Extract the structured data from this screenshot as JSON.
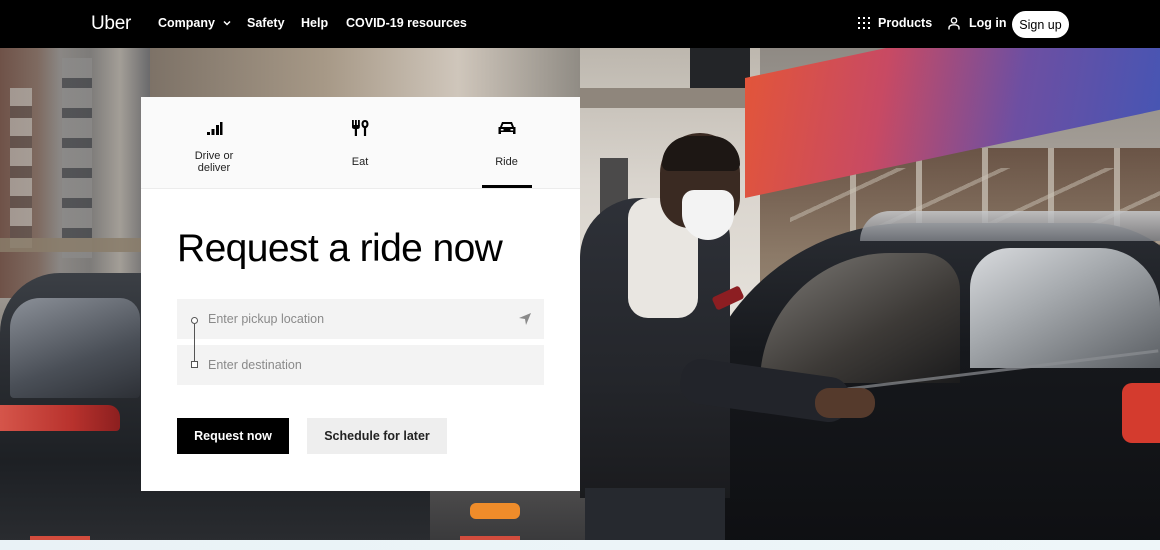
{
  "nav": {
    "logo": "Uber",
    "links": [
      {
        "label": "Company",
        "has_dropdown": true
      },
      {
        "label": "Safety"
      },
      {
        "label": "Help"
      },
      {
        "label": "COVID-19 resources"
      }
    ],
    "products_label": "Products",
    "login_label": "Log in",
    "signup_label": "Sign up"
  },
  "card": {
    "tabs": [
      {
        "label": "Drive or deliver",
        "icon": "signal-bars-icon",
        "active": false
      },
      {
        "label": "Eat",
        "icon": "fork-spoon-icon",
        "active": false
      },
      {
        "label": "Ride",
        "icon": "car-icon",
        "active": true
      }
    ],
    "title": "Request a ride now",
    "pickup": {
      "placeholder": "Enter pickup location",
      "value": ""
    },
    "destination": {
      "placeholder": "Enter destination",
      "value": ""
    },
    "request_button": "Request now",
    "schedule_button": "Schedule for later"
  },
  "colors": {
    "nav_bg": "#000000",
    "primary_button": "#000000",
    "secondary_button": "#eeeeee",
    "input_bg": "#f3f3f3",
    "awning_gradient": [
      "#e2553a",
      "#3c57b8"
    ]
  }
}
